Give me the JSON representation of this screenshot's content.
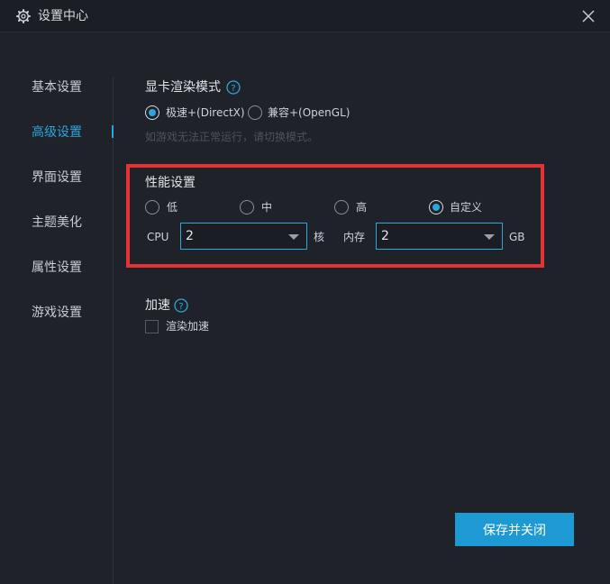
{
  "window": {
    "title": "设置中心",
    "title_icon": "gear-icon",
    "close_icon": "close-icon"
  },
  "sidebar": {
    "items": [
      {
        "label": "基本设置",
        "active": false
      },
      {
        "label": "高级设置",
        "active": true
      },
      {
        "label": "界面设置",
        "active": false
      },
      {
        "label": "主题美化",
        "active": false
      },
      {
        "label": "属性设置",
        "active": false
      },
      {
        "label": "游戏设置",
        "active": false
      }
    ]
  },
  "render_mode": {
    "title": "显卡渲染模式",
    "options": [
      {
        "label": "极速+(DirectX)",
        "checked": true
      },
      {
        "label": "兼容+(OpenGL)",
        "checked": false
      }
    ],
    "hint": "如游戏无法正常运行，请切换模式。"
  },
  "performance": {
    "title": "性能设置",
    "options": [
      {
        "label": "低",
        "checked": false
      },
      {
        "label": "中",
        "checked": false
      },
      {
        "label": "高",
        "checked": false
      },
      {
        "label": "自定义",
        "checked": true
      }
    ],
    "cpu_label": "CPU",
    "cpu_value": "2",
    "cpu_unit": "核",
    "memory_label": "内存",
    "memory_value": "2",
    "memory_unit": "GB"
  },
  "acceleration": {
    "title": "加速",
    "checkbox_label": "渲染加速",
    "checked": false
  },
  "footer": {
    "save_label": "保存并关闭"
  },
  "colors": {
    "accent": "#2ea5dd",
    "highlight": "#e53237",
    "background": "#1f2229"
  }
}
